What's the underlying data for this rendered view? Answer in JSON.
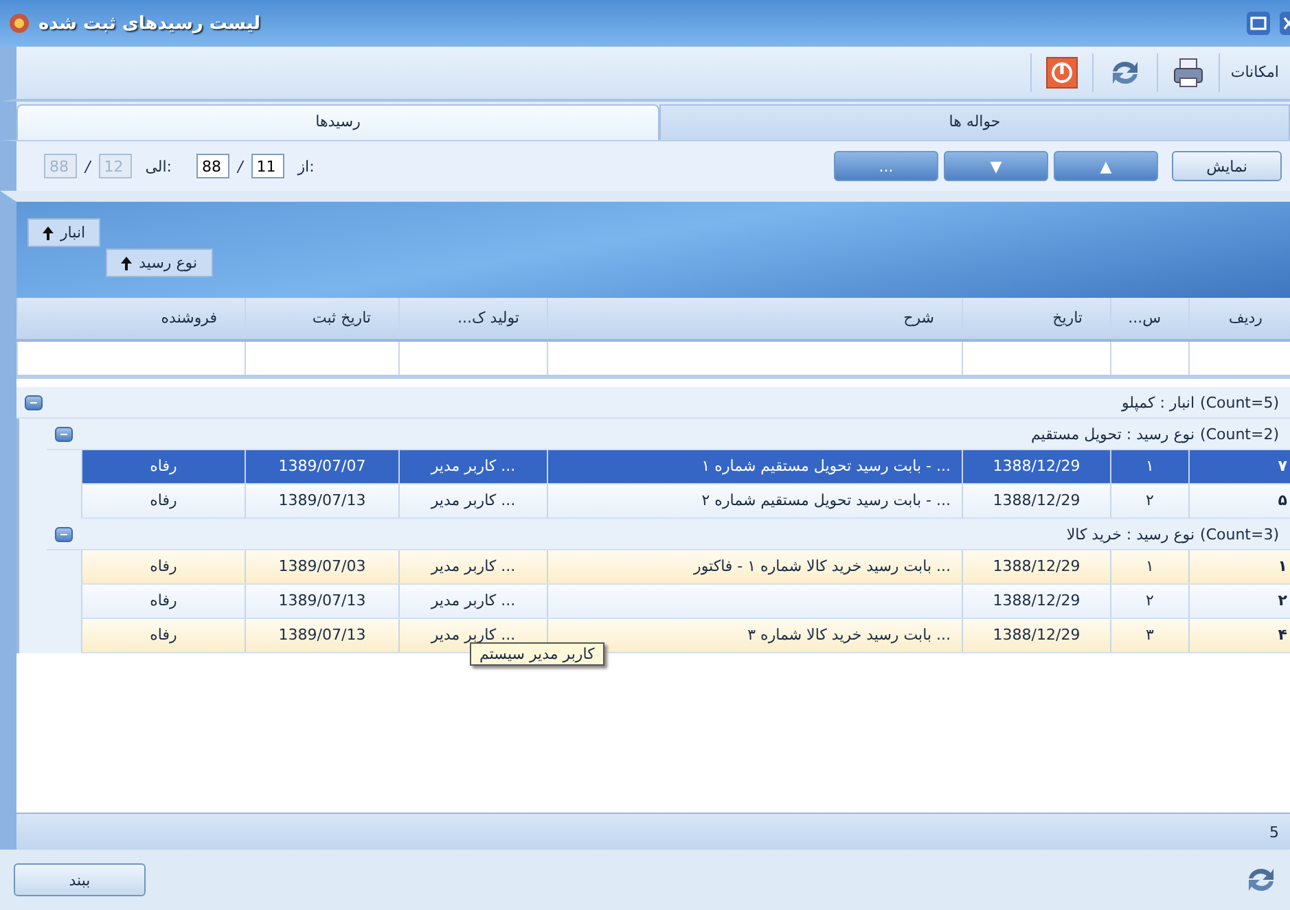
{
  "window": {
    "title": "لیست رسیدهای ثبت شده"
  },
  "toolbar": {
    "label": "امکانات"
  },
  "tabs": [
    {
      "label": "حواله ها",
      "selected": false
    },
    {
      "label": "رسیدها",
      "selected": true
    }
  ],
  "range": [
    {
      "label": "از:",
      "separator": "/",
      "fields": [
        {
          "value": "11",
          "disabled": false
        },
        {
          "value": "88",
          "disabled": false
        }
      ]
    },
    {
      "label": "الی:",
      "separator": "/",
      "fields": [
        {
          "value": "12",
          "disabled": true
        },
        {
          "value": "88",
          "disabled": true
        }
      ]
    }
  ],
  "nav_buttons": [
    {
      "label": "نمایش",
      "kind": "text"
    },
    {
      "label": "▲",
      "kind": "glyph"
    },
    {
      "label": "▼",
      "kind": "glyph"
    },
    {
      "label": "...",
      "kind": "glyph"
    }
  ],
  "group_chips": [
    {
      "label": "انبار"
    },
    {
      "label": "نوع رسید"
    }
  ],
  "table": {
    "columns": [
      "ردیف",
      "س...",
      "تاریخ",
      "شرح",
      "تولید ک...",
      "تاریخ ثبت",
      "فروشنده"
    ],
    "groups": [
      {
        "count": "(Count=5)",
        "label": "انبار : کمپلو",
        "expanded": true,
        "children": [
          {
            "count": "(Count=2)",
            "label": "نوع رسید : تحویل مستقیم",
            "expanded": true,
            "rows": [
              {
                "cells": [
                  "۷",
                  "۱",
                  "1388/12/29",
                  "... - بابت رسید تحویل مستقیم شماره ۱",
                  "... کاربر مدیر",
                  "1389/07/07",
                  "رفاه"
                ],
                "selected": true
              },
              {
                "cells": [
                  "۵",
                  "۲",
                  "1388/12/29",
                  "... - بابت رسید تحویل مستقیم شماره ۲",
                  "... کاربر مدیر",
                  "1389/07/13",
                  "رفاه"
                ],
                "selected": false
              }
            ]
          },
          {
            "count": "(Count=3)",
            "label": "نوع رسید : خرید کالا",
            "expanded": true,
            "rows": [
              {
                "cells": [
                  "۱",
                  "۱",
                  "1388/12/29",
                  "... بابت رسید خرید کالا شماره ۱ - فاکتور",
                  "... کاربر مدیر",
                  "1389/07/03",
                  "رفاه"
                ],
                "selected": false
              },
              {
                "cells": [
                  "۲",
                  "۲",
                  "1388/12/29",
                  "",
                  "... کاربر مدیر",
                  "1389/07/13",
                  "رفاه"
                ],
                "selected": false
              },
              {
                "cells": [
                  "۴",
                  "۳",
                  "1388/12/29",
                  "... بابت رسید خرید کالا شماره ۳",
                  "... کاربر مدیر",
                  "1389/07/13",
                  "رفاه"
                ],
                "selected": false
              }
            ]
          }
        ]
      }
    ]
  },
  "tooltip": "کاربر مدیر سیستم",
  "footer": {
    "count": "5"
  },
  "close_button": {
    "label": "ببند"
  }
}
